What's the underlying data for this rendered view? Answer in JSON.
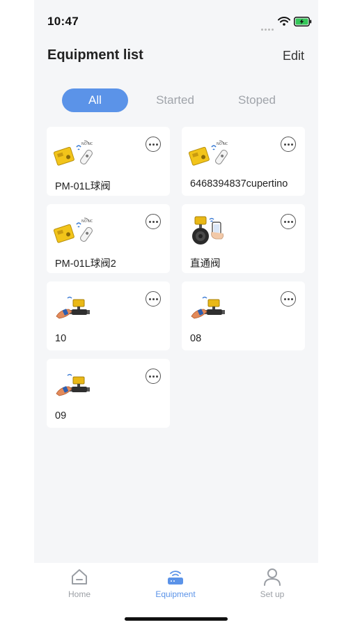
{
  "status_bar": {
    "time": "10:47"
  },
  "header": {
    "title": "Equipment list",
    "edit_label": "Edit"
  },
  "filters": [
    {
      "label": "All",
      "active": true
    },
    {
      "label": "Started",
      "active": false
    },
    {
      "label": "Stoped",
      "active": false
    }
  ],
  "devices": [
    {
      "name": "PM-01L球阀",
      "icon": "yellow-actuator-remote-icon"
    },
    {
      "name": "6468394837cupertino",
      "icon": "yellow-actuator-remote-icon"
    },
    {
      "name": "PM-01L球阀2",
      "icon": "yellow-actuator-remote-icon"
    },
    {
      "name": "直通阀",
      "icon": "butterfly-valve-phone-icon"
    },
    {
      "name": "10",
      "icon": "valve-hand-icon"
    },
    {
      "name": "08",
      "icon": "valve-hand-icon"
    },
    {
      "name": "09",
      "icon": "valve-hand-icon"
    }
  ],
  "tabbar": {
    "home": "Home",
    "equipment": "Equipment",
    "setup": "Set up",
    "active_color": "#5b93e8",
    "inactive_color": "#9a9ea4"
  },
  "colors": {
    "accent": "#5b93e8",
    "background": "#f5f6f8",
    "card": "#ffffff"
  }
}
